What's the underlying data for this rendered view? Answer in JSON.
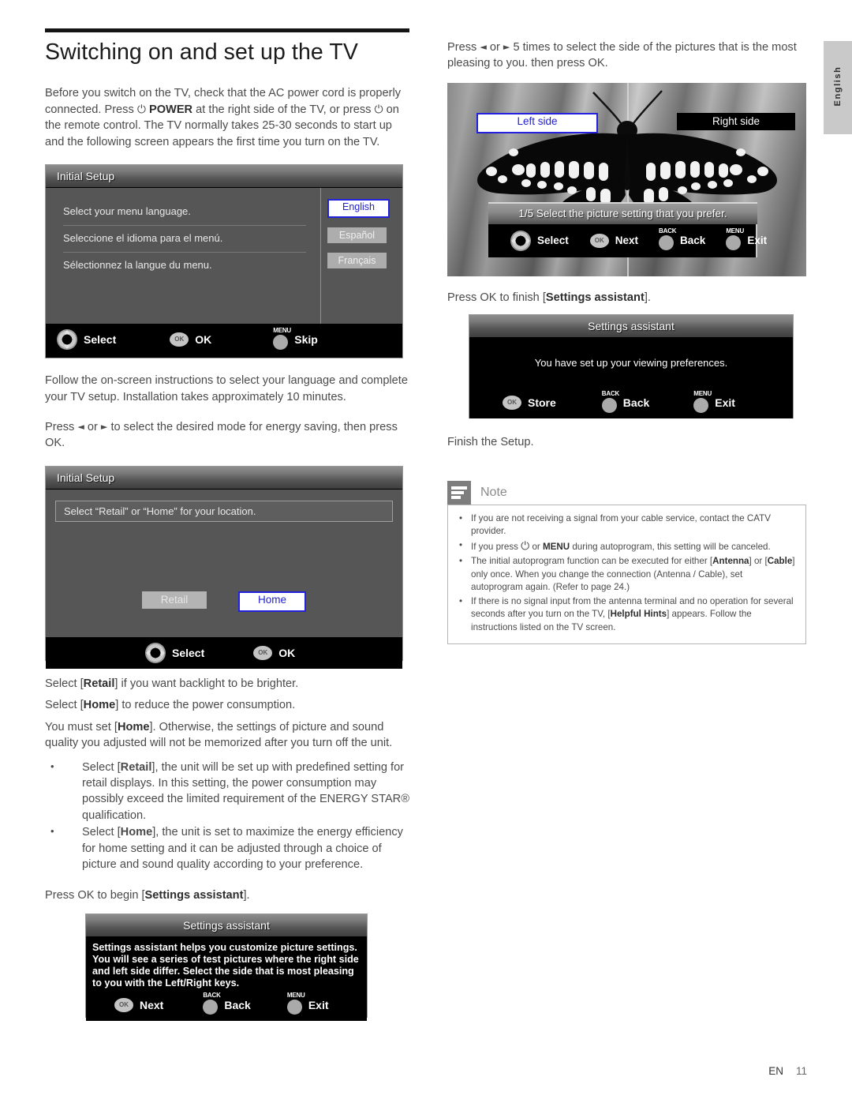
{
  "page": {
    "title": "Switching on and set up the TV",
    "side_tab_label": "English",
    "footer_code": "EN",
    "footer_page": "11"
  },
  "left_column": {
    "intro_paragraph": "Before you switch on the TV, check that the AC power cord is properly connected. Press ⏻ POWER at the right side of the TV, or press ⏻ on the remote control. The TV normally takes 25-30 seconds to start up and the following screen appears the first time you turn on the TV.",
    "after_language_paragraph": "Follow the on-screen instructions to select your language and complete your TV setup. Installation takes approximately 10 minutes.",
    "energy_paragraph": "Press ◄ or ► to select the desired mode for energy saving, then press OK.",
    "retail_line": "Select [Retail] if you want backlight to be brighter.",
    "home_line": "Select [Home] to reduce the power consumption.",
    "must_set_line": "You must set [Home]. Otherwise, the settings of picture and sound quality you adjusted will not be memorized after you turn off the unit.",
    "bullets": [
      "Select [Retail], the unit will be set up with predefined setting for retail displays. In this setting, the power consumption may possibly exceed the limited requirement of the ENERGY STAR® qualification.",
      "Select [Home], the unit is set to maximize the energy efficiency for home setting and it can be adjusted through a choice of picture and sound quality according to your preference."
    ],
    "begin_assistant_line": "Press OK to begin [Settings assistant]."
  },
  "osd_language": {
    "title": "Initial Setup",
    "rows": [
      "Select your menu language.",
      "Seleccione el idioma para el menú.",
      "Sélectionnez la langue du menu."
    ],
    "options": [
      {
        "label": "English",
        "selected": true
      },
      {
        "label": "Español",
        "selected": false
      },
      {
        "label": "Français",
        "selected": false
      }
    ],
    "footer": [
      {
        "icon": "dpad-up-down-icon",
        "label": "Select"
      },
      {
        "icon": "ok-button-icon",
        "label": "OK"
      },
      {
        "icon": "menu-button-icon",
        "cap": "MENU",
        "label": "Skip"
      }
    ]
  },
  "osd_location": {
    "title": "Initial Setup",
    "banner": "Select “Retail” or “Home” for your location.",
    "options": [
      {
        "label": "Retail",
        "selected": false
      },
      {
        "label": "Home",
        "selected": true
      }
    ],
    "footer": [
      {
        "icon": "dpad-left-right-icon",
        "label": "Select"
      },
      {
        "icon": "ok-button-icon",
        "label": "OK"
      }
    ]
  },
  "osd_assistant_intro": {
    "title": "Settings assistant",
    "text": "Settings assistant helps you customize picture settings. You will see a series of test pictures where the right side and left side differ. Select the side that is most pleasing to you with the Left/Right keys.",
    "footer": [
      {
        "icon": "ok-button-icon",
        "label": "Next"
      },
      {
        "icon": "back-button-icon",
        "cap": "BACK",
        "label": "Back"
      },
      {
        "icon": "menu-button-icon",
        "cap": "MENU",
        "label": "Exit"
      }
    ]
  },
  "right_column": {
    "intro_paragraph": "Press ◄ or ► 5 times to select the side of the pictures that is the most pleasing to you. then press OK.",
    "finish_assistant_line": "Press OK to finish [Settings assistant].",
    "finish_setup_line": "Finish the Setup."
  },
  "picture_screen": {
    "left_tag": "Left side",
    "right_tag": "Right side",
    "prompt": "1/5 Select the picture setting that you prefer.",
    "footer": [
      {
        "icon": "dpad-left-right-icon",
        "label": "Select"
      },
      {
        "icon": "ok-button-icon",
        "label": "Next"
      },
      {
        "icon": "back-button-icon",
        "cap": "BACK",
        "label": "Back"
      },
      {
        "icon": "menu-button-icon",
        "cap": "MENU",
        "label": "Exit"
      }
    ]
  },
  "osd_assistant_done": {
    "title": "Settings assistant",
    "text": "You have set up your viewing preferences.",
    "footer": [
      {
        "icon": "ok-button-icon",
        "label": "Store"
      },
      {
        "icon": "back-button-icon",
        "cap": "BACK",
        "label": "Back"
      },
      {
        "icon": "menu-button-icon",
        "cap": "MENU",
        "label": "Exit"
      }
    ]
  },
  "note": {
    "label": "Note",
    "items": [
      "If you are not receiving a signal from your cable service, contact the CATV provider.",
      "If you press ⏻ or MENU during autoprogram, this setting will be canceled.",
      "The initial autoprogram function can be executed for either [Antenna] or [Cable] only once. When you change the connection (Antenna / Cable), set autoprogram again. (Refer to page 24.)",
      "If there is no signal input from the antenna terminal and no operation for several seconds after you turn on the TV, [Helpful Hints] appears. Follow the instructions listed on the TV screen."
    ]
  },
  "colors": {
    "selection_blue": "#2222dd",
    "osd_body_gray": "#565656",
    "osd_button_gray": "#adadad",
    "note_icon_gray": "#7d7d7d"
  }
}
